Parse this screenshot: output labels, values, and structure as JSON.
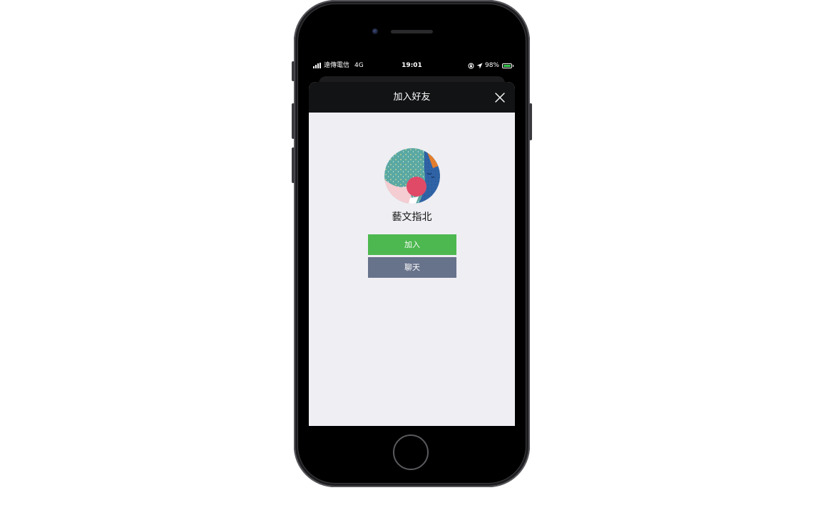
{
  "status_bar": {
    "carrier": "遠傳電信",
    "network": "4G",
    "time": "19:01",
    "battery": "98%",
    "battery_level": 0.98,
    "icons": [
      "signal-icon",
      "rotation-lock-icon",
      "location-arrow-icon",
      "battery-charging-icon"
    ]
  },
  "sheet": {
    "title": "加入好友",
    "close_icon": "close-icon"
  },
  "profile": {
    "name": "藝文指北",
    "avatar": "artwork-avatar"
  },
  "actions": {
    "add_label": "加入",
    "chat_label": "聊天"
  },
  "colors": {
    "add_button": "#4db84f",
    "chat_button": "#67728b",
    "header": "#121315",
    "background": "#efeef3"
  }
}
